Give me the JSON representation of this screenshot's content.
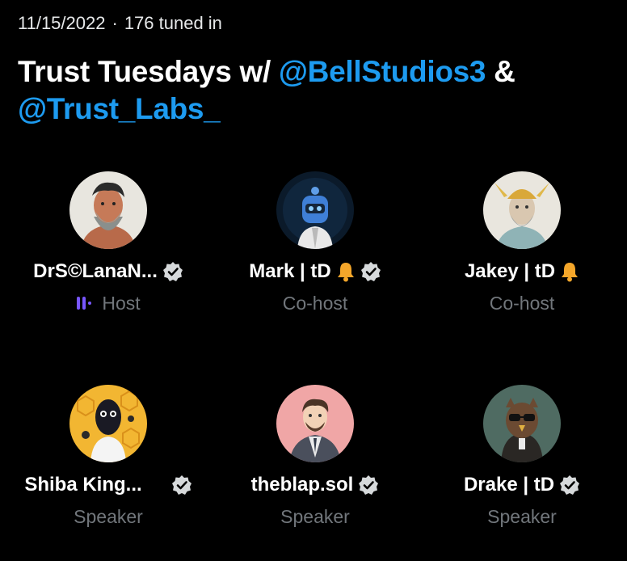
{
  "space": {
    "date": "11/15/2022",
    "separator": "·",
    "listeners": "176 tuned in",
    "title_prefix": "Trust Tuesdays w/ ",
    "mention_1": "@BellStudios3",
    "title_joiner": " & ",
    "mention_2": "@Trust_Labs_"
  },
  "colors": {
    "background": "#000000",
    "mention": "#1d9bf0",
    "role_text": "#71767b",
    "speaking_indicator": "#7856ff",
    "bell": "#f4a62a",
    "verified_badge": "#d6d9db"
  },
  "participants": [
    {
      "name": "DrS©LanaN...",
      "role": "Host",
      "verified": true,
      "bell": false,
      "speaking": true,
      "avatar_icon": "bearded-man-avatar"
    },
    {
      "name": "Mark | tD",
      "role": "Co-host",
      "verified": true,
      "bell": true,
      "speaking": false,
      "avatar_icon": "robot-astronaut-avatar"
    },
    {
      "name": "Jakey | tD",
      "role": "Co-host",
      "verified": false,
      "bell": true,
      "speaking": false,
      "avatar_icon": "winged-helmet-avatar"
    },
    {
      "name": "Shiba King...",
      "role": "Speaker",
      "verified": true,
      "bell": false,
      "speaking": false,
      "avatar_icon": "bee-hive-avatar"
    },
    {
      "name": "theblap.sol",
      "role": "Speaker",
      "verified": true,
      "bell": false,
      "speaking": false,
      "avatar_icon": "suited-man-avatar"
    },
    {
      "name": "Drake | tD",
      "role": "Speaker",
      "verified": true,
      "bell": false,
      "speaking": false,
      "avatar_icon": "owl-avatar"
    }
  ]
}
